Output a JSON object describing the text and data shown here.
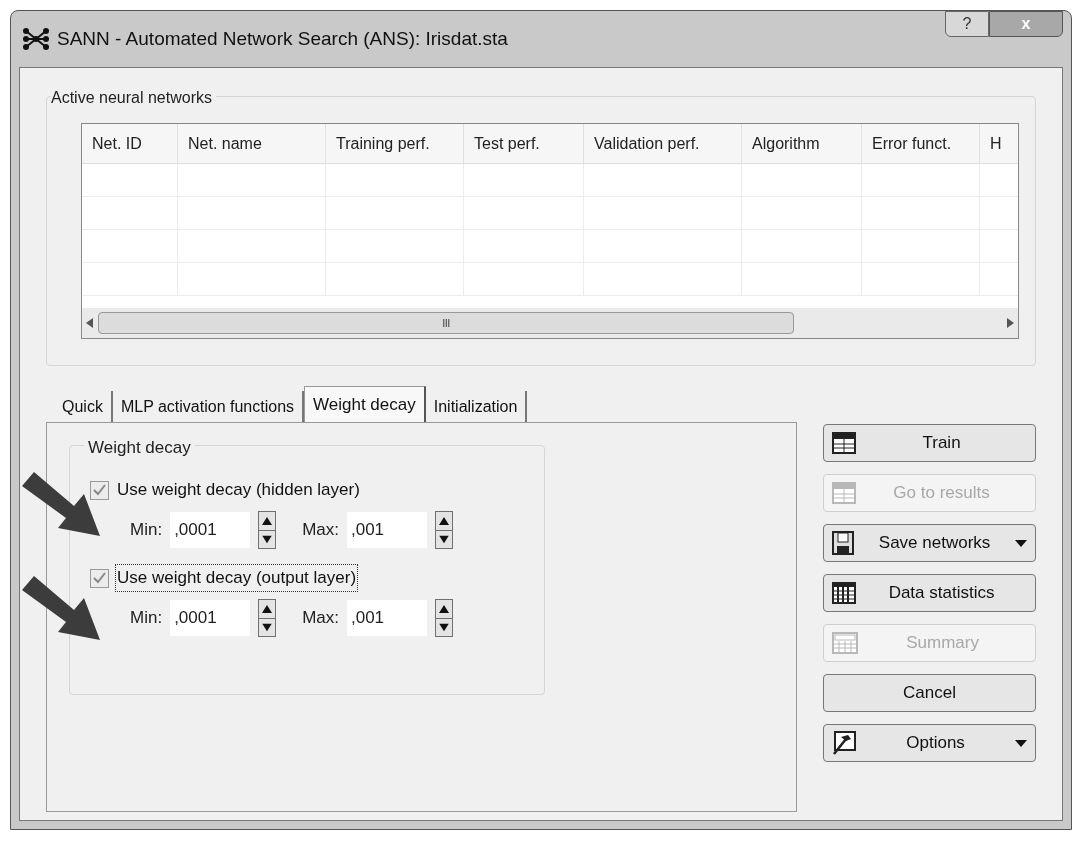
{
  "window": {
    "title": "SANN - Automated Network Search (ANS): Irisdat.sta",
    "help_button": "?",
    "close_button": "x"
  },
  "networks_group": {
    "title": "Active neural networks",
    "columns": [
      "Net. ID",
      "Net. name",
      "Training perf.",
      "Test perf.",
      "Validation perf.",
      "Algorithm",
      "Error funct.",
      "H"
    ],
    "scroll_grip": "III"
  },
  "tabs": [
    {
      "label": "Quick",
      "selected": false
    },
    {
      "label": "MLP activation functions",
      "selected": false
    },
    {
      "label": "Weight decay",
      "selected": true
    },
    {
      "label": "Initialization",
      "selected": false
    }
  ],
  "weight_decay_group": {
    "title": "Weight decay",
    "options": [
      {
        "label": "Use weight decay (hidden layer)",
        "checked": true,
        "focused": false,
        "min_label": "Min:",
        "min_value": ",0001",
        "max_label": "Max:",
        "max_value": ",001"
      },
      {
        "label": "Use weight decay (output layer)",
        "checked": true,
        "focused": true,
        "min_label": "Min:",
        "min_value": ",0001",
        "max_label": "Max:",
        "max_value": ",001"
      }
    ]
  },
  "buttons": [
    {
      "label": "Train",
      "kind": "table",
      "disabled": false,
      "dropdown": false
    },
    {
      "label": "Go to results",
      "kind": "table",
      "disabled": true,
      "dropdown": false
    },
    {
      "label": "Save networks",
      "kind": "disk",
      "disabled": false,
      "dropdown": true
    },
    {
      "label": "Data statistics",
      "kind": "grid",
      "disabled": false,
      "dropdown": false
    },
    {
      "label": "Summary",
      "kind": "summary",
      "disabled": true,
      "dropdown": false
    },
    {
      "label": "Cancel",
      "kind": "none",
      "disabled": false,
      "dropdown": false
    },
    {
      "label": "Options",
      "kind": "hammer",
      "disabled": false,
      "dropdown": true
    }
  ]
}
